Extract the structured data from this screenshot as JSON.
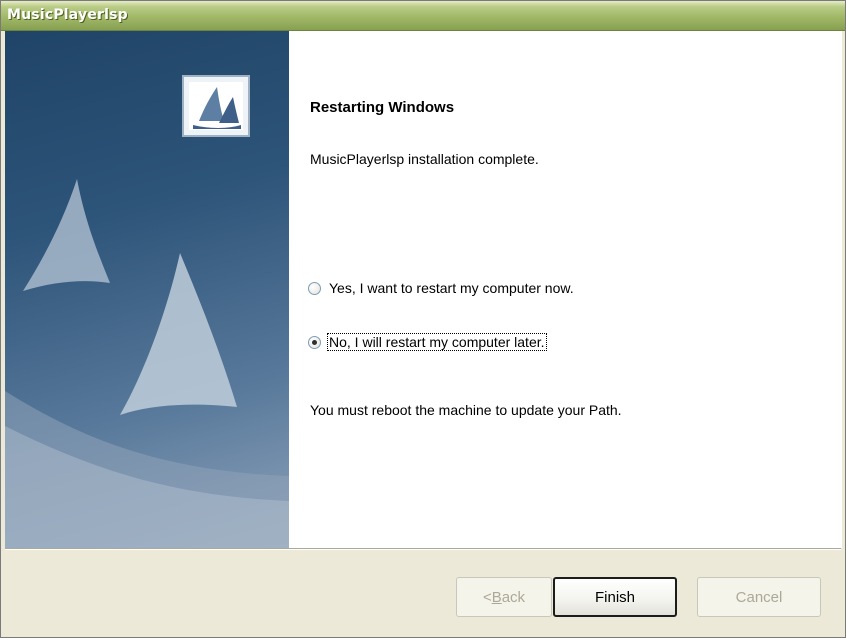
{
  "window": {
    "title": "MusicPlayerlsp"
  },
  "page": {
    "heading": "Restarting Windows",
    "message": "MusicPlayerlsp installation complete.",
    "options": [
      {
        "label": "Yes, I want to restart my computer now.",
        "checked": false
      },
      {
        "label": "No, I will restart my computer later.",
        "checked": true
      }
    ],
    "note": "You must reboot the machine to update your Path."
  },
  "buttons": {
    "back": {
      "prefix": "< ",
      "accel": "B",
      "rest": "ack",
      "enabled": false
    },
    "finish": {
      "label": "Finish",
      "enabled": true
    },
    "cancel": {
      "label": "Cancel",
      "enabled": false
    }
  },
  "colors": {
    "titlebar": "#a1b867",
    "sidebar": "#2d5479"
  },
  "icons": {
    "installer": "installer-sail-icon"
  }
}
